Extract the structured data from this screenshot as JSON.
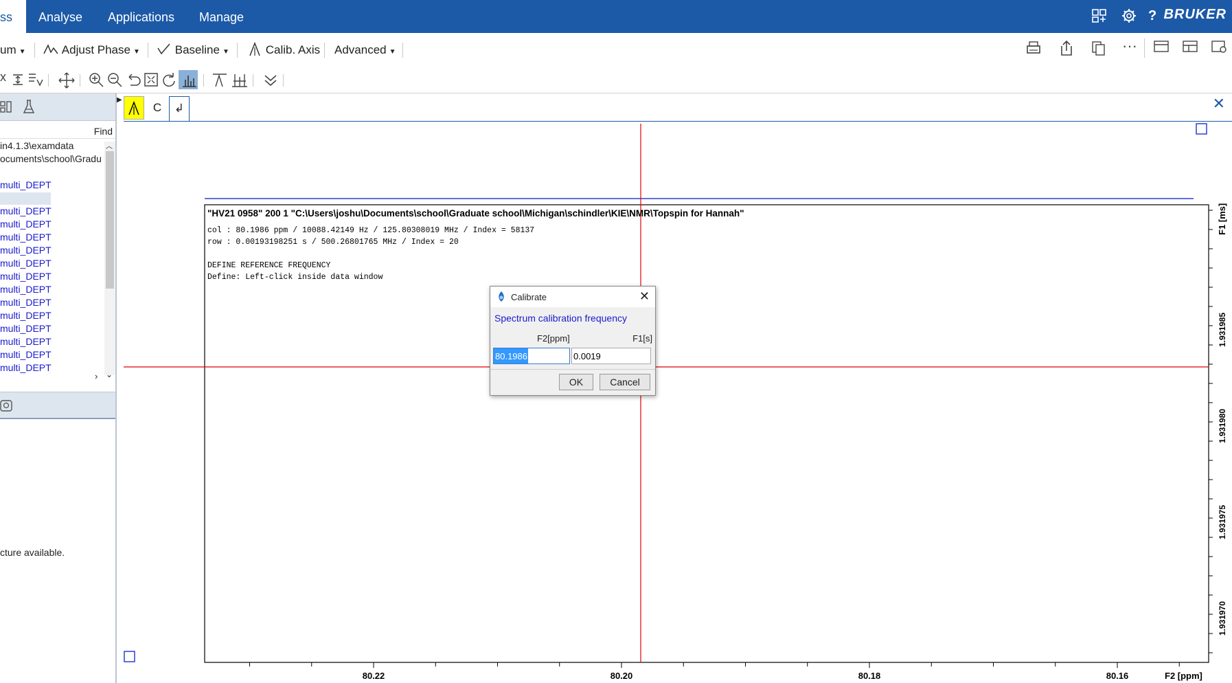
{
  "menubar": {
    "tabs": [
      "ss",
      "Analyse",
      "Applications",
      "Manage"
    ],
    "brand": "BRUKER",
    "icons": [
      "layout-icon",
      "gear-icon",
      "help-icon"
    ]
  },
  "toolbar1": {
    "spectrum": "um",
    "adjust_phase": "Adjust Phase",
    "baseline": "Baseline",
    "calib_axis": "Calib. Axis",
    "advanced": "Advanced"
  },
  "leftpanel": {
    "find": "Find",
    "paths": [
      "in4.1.3\\examdata",
      "ocuments\\school\\Gradu"
    ],
    "datasets": [
      "multi_DEPT",
      "",
      "multi_DEPT",
      "multi_DEPT",
      "multi_DEPT",
      "multi_DEPT",
      "multi_DEPT",
      "multi_DEPT",
      "multi_DEPT",
      "multi_DEPT",
      "multi_DEPT",
      "multi_DEPT",
      "multi_DEPT",
      "multi_DEPT",
      "multi_DEPT"
    ],
    "structure_text": "cture available."
  },
  "datawindow": {
    "tabs": [
      "A",
      "C",
      "↲"
    ],
    "title": "\"HV21 0958\"  200  1  \"C:\\Users\\joshu\\Documents\\school\\Graduate school\\Michigan\\schindler\\KIE\\NMR\\Topspin for Hannah\"",
    "info": [
      "col : 80.1986 ppm / 10088.42149 Hz / 125.80308019 MHz /  Index = 58137",
      "row : 0.00193198251 s / 500.26801765 MHz /  Index = 20",
      "",
      "DEFINE REFERENCE FREQUENCY",
      "Define: Left-click inside data window"
    ],
    "x_ticks": [
      {
        "label": "80.22",
        "value": 80.22
      },
      {
        "label": "80.20",
        "value": 80.2
      },
      {
        "label": "80.18",
        "value": 80.18
      },
      {
        "label": "80.16",
        "value": 80.16
      }
    ],
    "x_axis_label": "F2 [ppm]",
    "y_ticks": [
      "1.931985",
      "1.931980",
      "1.931975",
      "1.931970"
    ],
    "y_axis_label": "F1 [ms]"
  },
  "dialog": {
    "title": "Calibrate",
    "subtitle": "Spectrum calibration frequency",
    "col_f2": "F2[ppm]",
    "col_f1": "F1[s]",
    "f2_value": "80.1986",
    "f1_value": "0.0019",
    "ok": "OK",
    "cancel": "Cancel"
  },
  "colors": {
    "menubar": "#1c5aa8",
    "cursor": "#e00000",
    "link": "#1a1acd"
  }
}
